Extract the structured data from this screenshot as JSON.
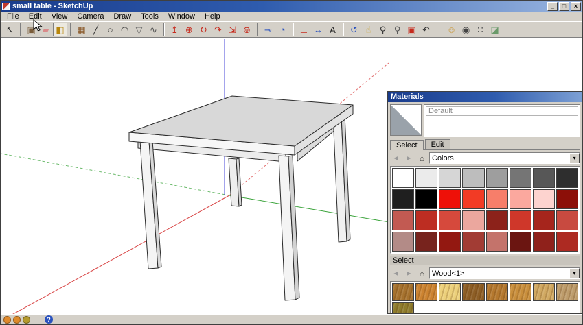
{
  "window": {
    "title": "small table - SketchUp",
    "controls": [
      {
        "name": "minimize-button",
        "glyph": "_"
      },
      {
        "name": "maximize-button",
        "glyph": "□"
      },
      {
        "name": "close-button",
        "glyph": "×"
      }
    ]
  },
  "menus": [
    {
      "label": "File"
    },
    {
      "label": "Edit"
    },
    {
      "label": "View"
    },
    {
      "label": "Camera"
    },
    {
      "label": "Draw"
    },
    {
      "label": "Tools"
    },
    {
      "label": "Window"
    },
    {
      "label": "Help"
    }
  ],
  "toolbar_groups": [
    {
      "tools": [
        {
          "name": "select-tool",
          "glyph": "↖",
          "color": "#1a1a1a"
        }
      ]
    },
    {
      "tools": [
        {
          "name": "make-component-tool",
          "glyph": "▣",
          "color": "#7a5c3a"
        },
        {
          "name": "eraser-tool",
          "glyph": "▰",
          "color": "#d98a8a"
        },
        {
          "name": "paint-bucket-tool",
          "glyph": "◧",
          "color": "#b8860b",
          "active": true
        }
      ]
    },
    {
      "tools": [
        {
          "name": "rectangle-tool",
          "glyph": "▦",
          "color": "#8b5a2b"
        },
        {
          "name": "line-tool",
          "glyph": "╱",
          "color": "#333333"
        },
        {
          "name": "circle-tool",
          "glyph": "○",
          "color": "#333333"
        },
        {
          "name": "arc-tool",
          "glyph": "◠",
          "color": "#333333"
        },
        {
          "name": "polygon-tool",
          "glyph": "▽",
          "color": "#666666"
        },
        {
          "name": "freehand-tool",
          "glyph": "∿",
          "color": "#555555"
        }
      ]
    },
    {
      "tools": [
        {
          "name": "push-pull-tool",
          "glyph": "↥",
          "color": "#c62b1e"
        },
        {
          "name": "move-tool",
          "glyph": "⊕",
          "color": "#c62b1e"
        },
        {
          "name": "rotate-tool",
          "glyph": "↻",
          "color": "#c62b1e"
        },
        {
          "name": "follow-me-tool",
          "glyph": "↷",
          "color": "#c62b1e"
        },
        {
          "name": "scale-tool",
          "glyph": "⇲",
          "color": "#c62b1e"
        },
        {
          "name": "offset-tool",
          "glyph": "⊚",
          "color": "#c62b1e"
        }
      ]
    },
    {
      "tools": [
        {
          "name": "tape-measure-tool",
          "glyph": "⊸",
          "color": "#2a52be"
        },
        {
          "name": "protractor-tool",
          "glyph": "◔",
          "color": "#2a52be"
        }
      ]
    },
    {
      "tools": [
        {
          "name": "axes-tool",
          "glyph": "⊥",
          "color": "#c62b1e"
        },
        {
          "name": "dimension-tool",
          "glyph": "↔",
          "color": "#2a52be"
        },
        {
          "name": "text-tool",
          "glyph": "A",
          "color": "#222222"
        }
      ]
    },
    {
      "tools": [
        {
          "name": "orbit-tool",
          "glyph": "↺",
          "color": "#2a52be"
        },
        {
          "name": "pan-tool",
          "glyph": "☝",
          "color": "#caa53a"
        },
        {
          "name": "zoom-tool",
          "glyph": "⚲",
          "color": "#333333"
        },
        {
          "name": "zoom-window-tool",
          "glyph": "⚲",
          "color": "#555555"
        },
        {
          "name": "zoom-extents-tool",
          "glyph": "▣",
          "color": "#c62b1e"
        },
        {
          "name": "previous-view-tool",
          "glyph": "↶",
          "color": "#333333"
        }
      ]
    },
    {
      "gap": true,
      "tools": [
        {
          "name": "position-camera-tool",
          "glyph": "☺",
          "color": "#c8922a"
        },
        {
          "name": "look-around-tool",
          "glyph": "◉",
          "color": "#444444"
        },
        {
          "name": "walk-tool",
          "glyph": "∷",
          "color": "#555555"
        },
        {
          "name": "section-plane-tool",
          "glyph": "◪",
          "color": "#6a9a6a"
        }
      ]
    }
  ],
  "canvas": {
    "axes": {
      "red": "#d94545",
      "green": "#3aa33a",
      "blue": "#4a4ad8"
    }
  },
  "materials": {
    "title": "Materials",
    "default_name": "Default",
    "tabs": [
      {
        "label": "Select"
      },
      {
        "label": "Edit"
      }
    ],
    "nav": {
      "back": "◀",
      "forward": "▶",
      "home": "⌂",
      "dropdown_arrow": "▾"
    },
    "colors": {
      "dropdown": "Colors",
      "rows": [
        [
          "#ffffff",
          "#ebebeb",
          "#d6d6d6",
          "#bdbdbd",
          "#9e9e9e",
          "#757575",
          "#575757",
          "#2e2e2e"
        ],
        [
          "#1f1f1f",
          "#000000",
          "#ee1008",
          "#f23b25",
          "#f77e6a",
          "#fba89e",
          "#fdd3cf",
          "#8c0f08"
        ],
        [
          "#c25a52",
          "#bd2d22",
          "#d6493c",
          "#eba79e",
          "#8c221a",
          "#cf372a",
          "#a6251c",
          "#c84a40"
        ],
        [
          "#b38b87",
          "#77231d",
          "#931811",
          "#a23c34",
          "#c4736b",
          "#6b1511",
          "#8f211b",
          "#ad2a22"
        ]
      ]
    },
    "select_header": "Select",
    "wood": {
      "dropdown": "Wood<1>",
      "rows": [
        [
          "#a6722e",
          "#cc8330",
          "#ecd07a",
          "#8d5e25",
          "#b4782e",
          "#c98f3c",
          "#d0a861",
          "#bd9c6b"
        ],
        [
          "#8e7c2c"
        ]
      ]
    }
  },
  "statusbar": {
    "icons": [
      {
        "name": "status-icon-1",
        "color": "#e08a2d"
      },
      {
        "name": "status-icon-2",
        "color": "#de8a2a"
      },
      {
        "name": "status-icon-3",
        "color": "#b59a2e"
      }
    ],
    "help": {
      "glyph": "?",
      "color": "#2a52be"
    }
  }
}
